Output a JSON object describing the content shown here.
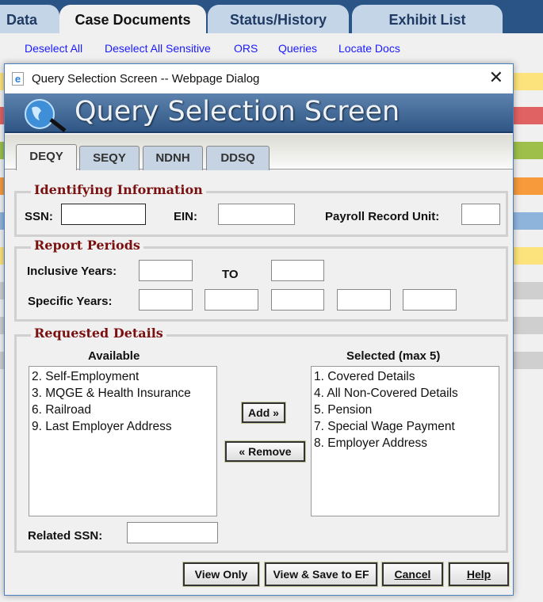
{
  "app_tabs": [
    {
      "label": "Data"
    },
    {
      "label": "Case Documents"
    },
    {
      "label": "Status/History"
    },
    {
      "label": "Exhibit List"
    }
  ],
  "links": [
    "Deselect All",
    "Deselect All Sensitive",
    "ORS",
    "Queries",
    "Locate Docs"
  ],
  "stripe_colors": [
    "#fde37b",
    "#e06262",
    "#9ebf4a",
    "#f69a3c",
    "#8fb4dc",
    "#fde37b",
    "#cfcfcf",
    "#cfcfcf",
    "#cfcfcf"
  ],
  "dialog": {
    "window_title": "Query Selection Screen -- Webpage Dialog",
    "banner_title": "Query Selection Screen",
    "tabs": [
      "DEQY",
      "SEQY",
      "NDNH",
      "DDSQ"
    ],
    "identifying": {
      "legend": "Identifying Information",
      "ssn_label": "SSN:",
      "ein_label": "EIN:",
      "pru_label": "Payroll Record Unit:",
      "ssn": "",
      "ein": "",
      "pru": ""
    },
    "periods": {
      "legend": "Report Periods",
      "inclusive_label": "Inclusive Years:",
      "to_label": "TO",
      "specific_label": "Specific Years:"
    },
    "details": {
      "legend": "Requested Details",
      "available_label": "Available",
      "selected_label": "Selected (max 5)",
      "available": [
        "2. Self-Employment",
        "3. MQGE & Health Insurance",
        "6. Railroad",
        "9. Last Employer Address"
      ],
      "selected": [
        "1. Covered Details",
        "4. All Non-Covered Details",
        "5. Pension",
        "7. Special Wage Payment",
        "8. Employer Address"
      ],
      "add_label": "Add »",
      "remove_label": "« Remove",
      "related_ssn_label": "Related SSN:",
      "related_ssn": ""
    },
    "buttons": {
      "view_only": "View Only",
      "view_save": "View & Save to EF",
      "cancel": "Cancel",
      "help": "Help"
    }
  }
}
